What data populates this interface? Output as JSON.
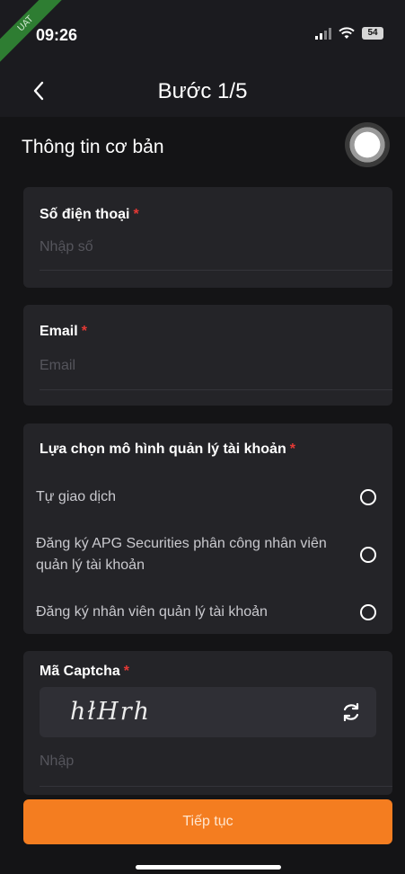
{
  "status_bar": {
    "time": "09:26",
    "env_tag": "UAT",
    "battery": "54"
  },
  "nav": {
    "back_icon": "chevron-left",
    "title": "Bước 1/5"
  },
  "section": {
    "title": "Thông tin cơ bản"
  },
  "phone": {
    "label": "Số điện thoại",
    "required": "*",
    "placeholder": "Nhập số"
  },
  "email": {
    "label": "Email",
    "required": "*",
    "placeholder": "Email"
  },
  "account_model": {
    "label": "Lựa chọn mô hình quản lý tài khoản",
    "required": "*",
    "options": [
      {
        "label": "Tự giao dịch",
        "selected": false
      },
      {
        "label": "Đăng ký APG Securities phân công nhân viên quản lý tài khoản",
        "selected": false
      },
      {
        "label": "Đăng ký nhân viên quản lý tài khoản",
        "selected": false
      }
    ]
  },
  "captcha": {
    "label": "Mã Captcha",
    "required": "*",
    "code": "hłHrh",
    "refresh_icon": "refresh-icon",
    "placeholder": "Nhập"
  },
  "submit": {
    "label": "Tiếp tục"
  },
  "colors": {
    "accent": "#f47d20",
    "required": "#e53935",
    "background": "#141416",
    "card": "#242428"
  }
}
